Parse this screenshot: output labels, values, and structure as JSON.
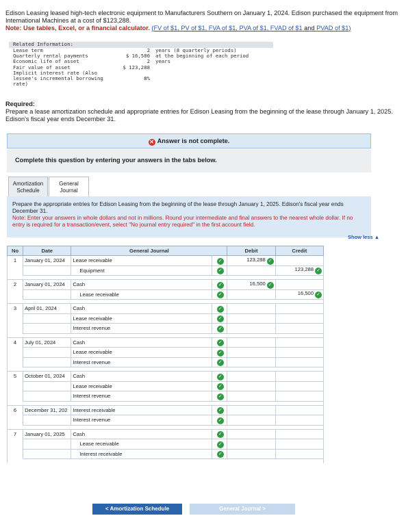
{
  "intro": {
    "text": "Edison Leasing leased high-tech electronic equipment to Manufacturers Southern on January 1, 2024. Edison purchased the equipment from International Machines at a cost of $123,288.",
    "note_label": "Note: Use tables, Excel, or a financial calculator.",
    "links": [
      "FV of $1",
      "PV of $1",
      "FVA of $1",
      "PVA of $1",
      "FVAD of $1"
    ],
    "link_and": "and",
    "last_link": "PVAD of $1"
  },
  "info": {
    "header": "Related Information:",
    "rows": [
      {
        "label": "Lease term",
        "amount": "2",
        "unit": "years (8 quarterly periods)"
      },
      {
        "label": "Quarterly rental payments",
        "amount": "$ 16,500",
        "unit": "at the beginning of each period"
      },
      {
        "label": "Economic life of asset",
        "amount": "2",
        "unit": "years"
      },
      {
        "label": "Fair value of asset",
        "amount": "$ 123,288",
        "unit": ""
      },
      {
        "label": "Implicit interest rate (Also",
        "amount": "",
        "unit": ""
      },
      {
        "label": "lessee's incremental borrowing",
        "amount": "8%",
        "unit": ""
      },
      {
        "label": "rate)",
        "amount": "",
        "unit": ""
      }
    ]
  },
  "required": {
    "heading": "Required:",
    "text": "Prepare a lease amortization schedule and appropriate entries for Edison Leasing from the beginning of the lease through January 1, 2025. Edison's fiscal year ends December 31."
  },
  "banner": {
    "status": "Answer is not complete."
  },
  "complete_prompt": "Complete this question by entering your answers in the tabs below.",
  "tabs": [
    {
      "line1": "Amortization",
      "line2": "Schedule"
    },
    {
      "line1": "General",
      "line2": "Journal"
    }
  ],
  "instructions": {
    "main": "Prepare the appropriate entries for Edison Leasing from the beginning of the lease through January 1, 2025. Edison's fiscal year ends December 31.",
    "note": "Note: Enter your answers in whole dollars and not in millions. Round your intermediate and final answers to the nearest whole dollar. If no entry is required for a transaction/event, select \"No journal entry required\" in the first account field."
  },
  "show_less": "Show less ▲",
  "table": {
    "headers": {
      "no": "No",
      "date": "Date",
      "journal": "General Journal",
      "debit": "Debit",
      "credit": "Credit"
    }
  },
  "entries": [
    {
      "no": "1",
      "date": "January 01, 2024",
      "lines": [
        {
          "account": "Lease receivable",
          "indent": false,
          "debit": "123,288",
          "credit": ""
        },
        {
          "account": "Equipment",
          "indent": true,
          "debit": "",
          "credit": "123,288"
        }
      ]
    },
    {
      "no": "2",
      "date": "January 01, 2024",
      "lines": [
        {
          "account": "Cash",
          "indent": false,
          "debit": "16,500",
          "credit": ""
        },
        {
          "account": "Lease receivable",
          "indent": true,
          "debit": "",
          "credit": "16,500"
        }
      ]
    },
    {
      "no": "3",
      "date": "April 01, 2024",
      "lines": [
        {
          "account": "Cash",
          "indent": false,
          "debit": "",
          "credit": ""
        },
        {
          "account": "Lease receivable",
          "indent": false,
          "debit": "",
          "credit": ""
        },
        {
          "account": "Interest revenue",
          "indent": false,
          "debit": "",
          "credit": ""
        }
      ]
    },
    {
      "no": "4",
      "date": "July 01, 2024",
      "lines": [
        {
          "account": "Cash",
          "indent": false,
          "debit": "",
          "credit": ""
        },
        {
          "account": "Lease receivable",
          "indent": false,
          "debit": "",
          "credit": ""
        },
        {
          "account": "Interest revenue",
          "indent": false,
          "debit": "",
          "credit": ""
        }
      ]
    },
    {
      "no": "5",
      "date": "October 01, 2024",
      "lines": [
        {
          "account": "Cash",
          "indent": false,
          "debit": "",
          "credit": ""
        },
        {
          "account": "Lease receivable",
          "indent": false,
          "debit": "",
          "credit": ""
        },
        {
          "account": "Interest revenue",
          "indent": false,
          "debit": "",
          "credit": ""
        }
      ]
    },
    {
      "no": "6",
      "date": "December 31, 202",
      "lines": [
        {
          "account": "Interest receivable",
          "indent": false,
          "debit": "",
          "credit": ""
        },
        {
          "account": "Interest revenue",
          "indent": false,
          "debit": "",
          "credit": ""
        }
      ]
    },
    {
      "no": "7",
      "date": "January 01, 2025",
      "lines": [
        {
          "account": "Cash",
          "indent": false,
          "debit": "",
          "credit": ""
        },
        {
          "account": "Lease receivable",
          "indent": true,
          "debit": "",
          "credit": ""
        },
        {
          "account": "Interest receivable",
          "indent": true,
          "debit": "",
          "credit": ""
        }
      ]
    }
  ],
  "nav": {
    "prev": "<  Amortization Schedule",
    "next": "General Journal  >"
  },
  "colors": {
    "accent": "#2a64ac",
    "check": "#2e9c42",
    "error": "#d93025",
    "banner": "#dbe9f7"
  }
}
